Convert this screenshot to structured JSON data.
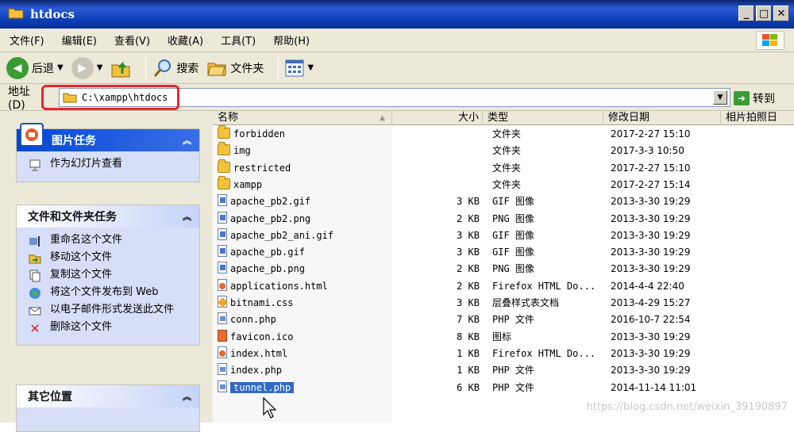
{
  "window": {
    "title": "htdocs"
  },
  "title_buttons": {
    "minimize": "_",
    "maximize": "□",
    "close": "✕"
  },
  "menu": [
    {
      "label": "文件(F)"
    },
    {
      "label": "编辑(E)"
    },
    {
      "label": "查看(V)"
    },
    {
      "label": "收藏(A)"
    },
    {
      "label": "工具(T)"
    },
    {
      "label": "帮助(H)"
    }
  ],
  "toolbar": {
    "back_label": "后退",
    "search_label": "搜索",
    "folders_label": "文件夹"
  },
  "address": {
    "label": "地址(D)",
    "value": "C:\\xampp\\htdocs",
    "go_label": "转到"
  },
  "left_panels": {
    "picture_tasks": {
      "title": "图片任务",
      "items": [
        {
          "label": "作为幻灯片查看",
          "icon": "slideshow-icon"
        }
      ]
    },
    "file_tasks": {
      "title": "文件和文件夹任务",
      "items": [
        {
          "label": "重命名这个文件",
          "icon": "rename-icon"
        },
        {
          "label": "移动这个文件",
          "icon": "move-icon"
        },
        {
          "label": "复制这个文件",
          "icon": "copy-icon"
        },
        {
          "label": "将这个文件发布到 Web",
          "icon": "publish-web-icon"
        },
        {
          "label": "以电子邮件形式发送此文件",
          "icon": "email-icon"
        },
        {
          "label": "删除这个文件",
          "icon": "delete-icon"
        }
      ]
    },
    "other_places": {
      "title": "其它位置"
    }
  },
  "columns": {
    "name": "名称",
    "size": "大小",
    "type": "类型",
    "modified": "修改日期",
    "photo_date": "相片拍照日"
  },
  "files": [
    {
      "name": "forbidden",
      "size": "",
      "type": "文件夹",
      "modified": "2017-2-27 15:10",
      "kind": "folder"
    },
    {
      "name": "img",
      "size": "",
      "type": "文件夹",
      "modified": "2017-3-3 10:50",
      "kind": "folder"
    },
    {
      "name": "restricted",
      "size": "",
      "type": "文件夹",
      "modified": "2017-2-27 15:10",
      "kind": "folder"
    },
    {
      "name": "xampp",
      "size": "",
      "type": "文件夹",
      "modified": "2017-2-27 15:14",
      "kind": "folder"
    },
    {
      "name": "apache_pb2.gif",
      "size": "3 KB",
      "type": "GIF 图像",
      "modified": "2013-3-30 19:29",
      "kind": "img"
    },
    {
      "name": "apache_pb2.png",
      "size": "2 KB",
      "type": "PNG 图像",
      "modified": "2013-3-30 19:29",
      "kind": "img"
    },
    {
      "name": "apache_pb2_ani.gif",
      "size": "3 KB",
      "type": "GIF 图像",
      "modified": "2013-3-30 19:29",
      "kind": "img"
    },
    {
      "name": "apache_pb.gif",
      "size": "3 KB",
      "type": "GIF 图像",
      "modified": "2013-3-30 19:29",
      "kind": "img"
    },
    {
      "name": "apache_pb.png",
      "size": "2 KB",
      "type": "PNG 图像",
      "modified": "2013-3-30 19:29",
      "kind": "img"
    },
    {
      "name": "applications.html",
      "size": "2 KB",
      "type": "Firefox HTML Do...",
      "modified": "2014-4-4 22:40",
      "kind": "html"
    },
    {
      "name": "bitnami.css",
      "size": "3 KB",
      "type": "层叠样式表文档",
      "modified": "2013-4-29 15:27",
      "kind": "css"
    },
    {
      "name": "conn.php",
      "size": "7 KB",
      "type": "PHP 文件",
      "modified": "2016-10-7 22:54",
      "kind": "php"
    },
    {
      "name": "favicon.ico",
      "size": "8 KB",
      "type": "图标",
      "modified": "2013-3-30 19:29",
      "kind": "ico"
    },
    {
      "name": "index.html",
      "size": "1 KB",
      "type": "Firefox HTML Do...",
      "modified": "2013-3-30 19:29",
      "kind": "html"
    },
    {
      "name": "index.php",
      "size": "1 KB",
      "type": "PHP 文件",
      "modified": "2013-3-30 19:29",
      "kind": "php"
    },
    {
      "name": "tunnel.php",
      "size": "6 KB",
      "type": "PHP 文件",
      "modified": "2014-11-14 11:01",
      "kind": "php",
      "selected": true
    }
  ],
  "watermark": "https://blog.csdn.net/weixin_39190897"
}
